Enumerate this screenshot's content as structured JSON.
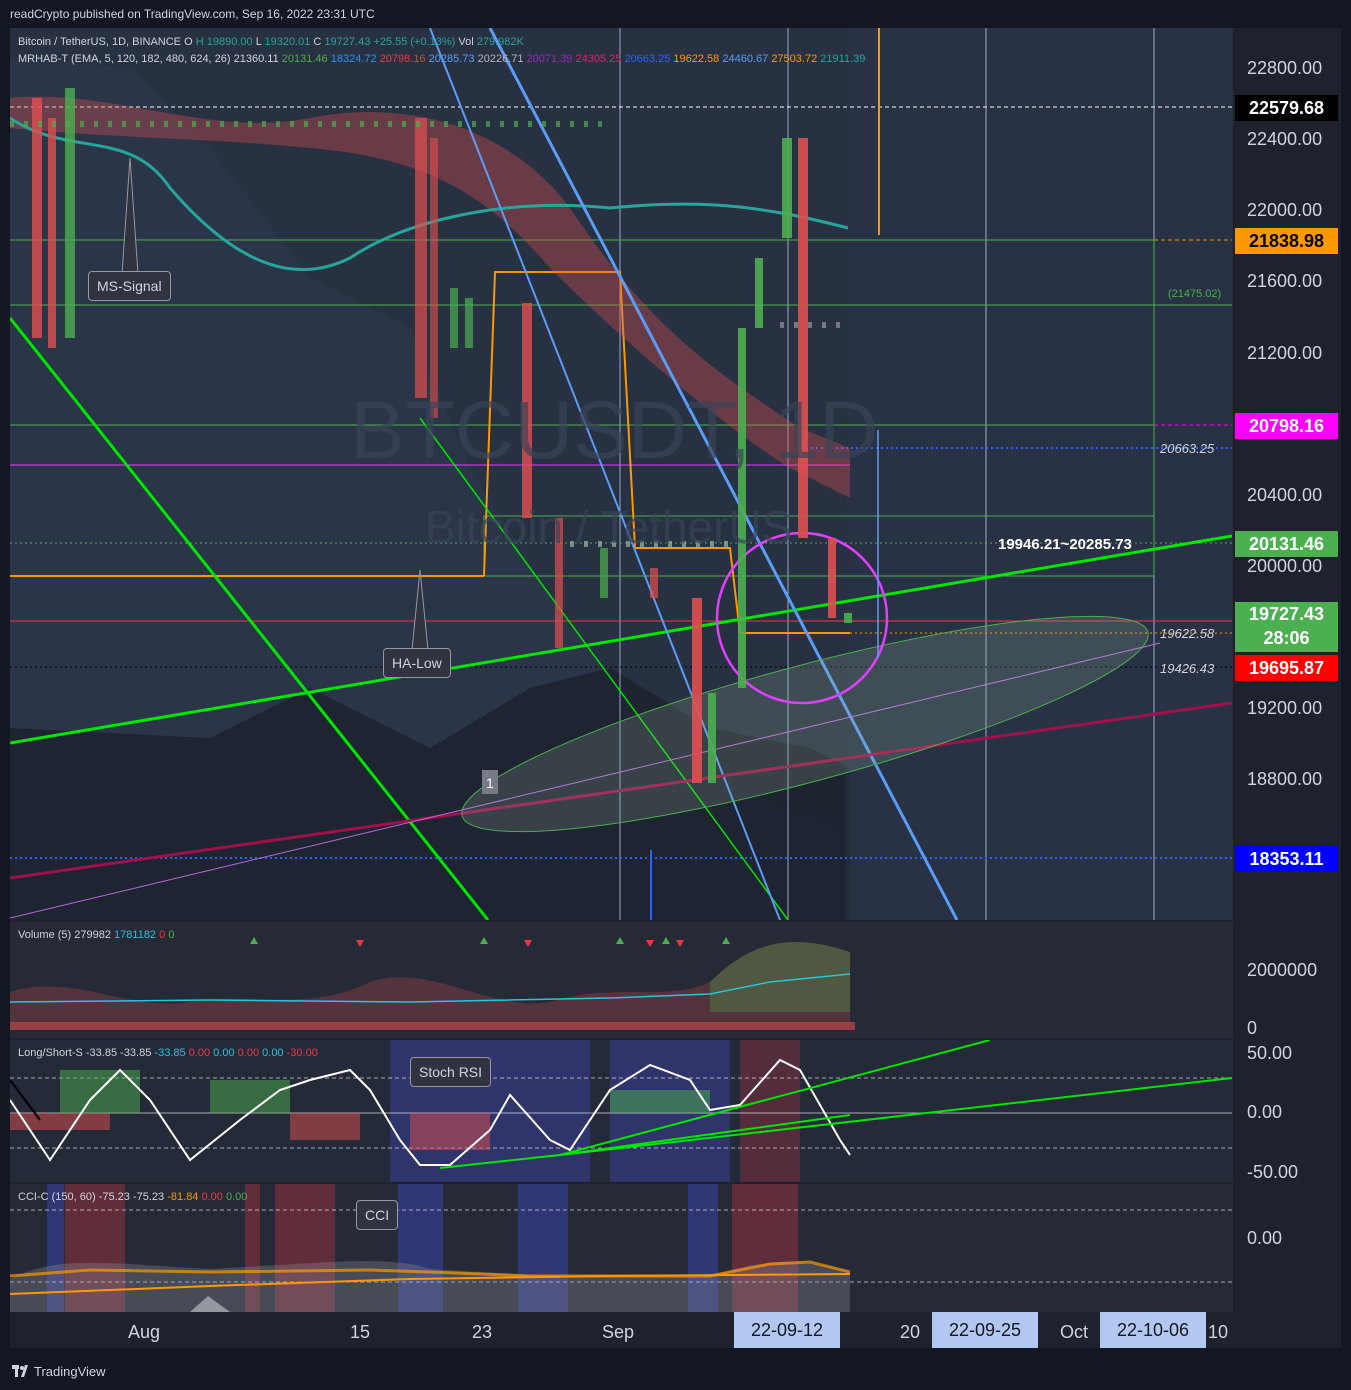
{
  "header": {
    "published": "readCrypto published on TradingView.com, Sep 16, 2022 23:31 UTC"
  },
  "legend": {
    "symbol": "Bitcoin / TetherUS, 1D, BINANCE",
    "ohlc_o": "O",
    "ohlc_h": "H",
    "ohlc_h_val": "19890.00",
    "ohlc_l": "L",
    "ohlc_l_val": "19320.01",
    "ohlc_c": "C",
    "ohlc_c_val": "19727.43",
    "change": "+25.55 (+0.13%)",
    "vol_label": "Vol",
    "vol_val": "279.982K",
    "mrhab": "MRHAB-T (EMA, 5, 120, 182, 480, 624, 26)",
    "mrhab_vals": [
      "21360.11",
      "20131.46",
      "18324.72",
      "20798.16",
      "20285.73",
      "20226.71",
      "20071.39",
      "24305.25",
      "20663.25",
      "19622.58",
      "24460.67",
      "27503.72",
      "21911.39"
    ]
  },
  "watermark": {
    "ticker": "BTCUSDT, 1D",
    "name": "Bitcoin / TetherUS"
  },
  "annotations": {
    "ms_signal": "MS-Signal",
    "ha_low": "HA-Low",
    "stoch_rsi": "Stoch RSI",
    "cci": "CCI",
    "range_label": "19946.21~20285.73",
    "label_21475": "(21475.02)",
    "marker_1": "1"
  },
  "price_axis": {
    "ticks": [
      "22800.00",
      "22400.00",
      "22000.00",
      "21600.00",
      "21200.00",
      "20400.00",
      "20000.00",
      "19200.00",
      "18800.00"
    ]
  },
  "price_badges": [
    {
      "value": "22579.68",
      "bg": "#000000",
      "fg": "#ffffff"
    },
    {
      "value": "21838.98",
      "bg": "#ff9800",
      "fg": "#000000"
    },
    {
      "value": "20798.16",
      "bg": "#ff00ff",
      "fg": "#ffffff"
    },
    {
      "value": "20131.46",
      "bg": "#4caf50",
      "fg": "#ffffff"
    },
    {
      "value": "19727.43",
      "bg": "#4caf50",
      "fg": "#ffffff"
    },
    {
      "value": "19695.87",
      "bg": "#ff0000",
      "fg": "#ffffff"
    },
    {
      "value": "18353.11",
      "bg": "#0000ff",
      "fg": "#ffffff"
    }
  ],
  "countdown": "28:06",
  "line_labels": {
    "l20663": "20663.25",
    "l19622": "19622.58",
    "l19426": "19426.43"
  },
  "volume": {
    "title": "Volume (5)",
    "v1": "279982",
    "v2": "1781182",
    "v3": "0",
    "v4": "0",
    "ticks": [
      "2000000",
      "0"
    ]
  },
  "longshort": {
    "title": "Long/Short-S",
    "vals": [
      "-33.85",
      "-33.85",
      "-33.85",
      "0.00",
      "0.00",
      "0.00",
      "0.00",
      "-30.00"
    ],
    "ticks": [
      "50.00",
      "0.00",
      "-50.00"
    ]
  },
  "cci": {
    "title": "CCI-C (150, 60)",
    "vals": [
      "-75.23",
      "-75.23",
      "-81.84",
      "0.00",
      "0.00"
    ],
    "ticks": [
      "0.00"
    ]
  },
  "time_axis": {
    "labels": [
      "Aug",
      "15",
      "23",
      "Sep",
      "20",
      "Oct",
      "10"
    ],
    "highlights": [
      "22-09-12",
      "22-09-25",
      "22-10-06"
    ]
  },
  "footer": {
    "brand": "TradingView"
  },
  "colors": {
    "up": "#4caf50",
    "down": "#f23645",
    "green_line": "#00e600",
    "blue_line": "#5b9cf6",
    "maroon_line": "#a0104a",
    "orange": "#ff9800",
    "magenta": "#e040fb"
  }
}
